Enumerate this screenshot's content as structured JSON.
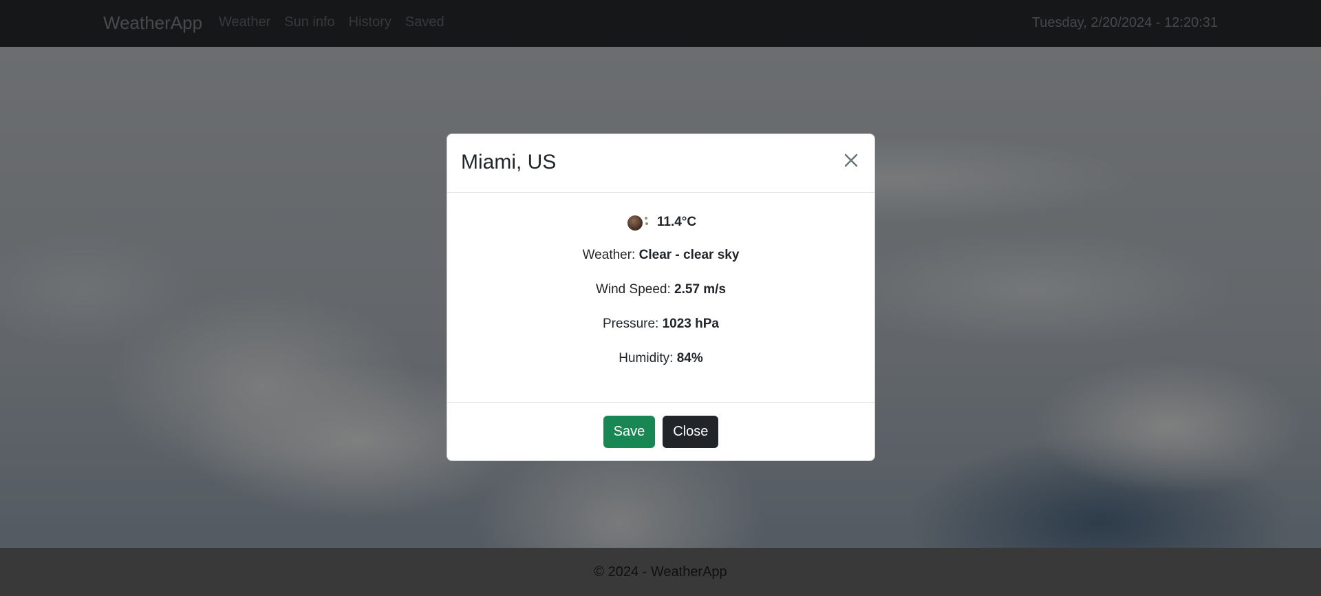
{
  "navbar": {
    "brand": "WeatherApp",
    "links": [
      "Weather",
      "Sun info",
      "History",
      "Saved"
    ],
    "datetime": "Tuesday, 2/20/2024 - 12:20:31"
  },
  "modal": {
    "title": "Miami, US",
    "temperature": "11.4°C",
    "weather_label": "Weather: ",
    "weather_value": "Clear - clear sky",
    "wind_label": "Wind Speed: ",
    "wind_value": "2.57 m/s",
    "pressure_label": "Pressure: ",
    "pressure_value": "1023 hPa",
    "humidity_label": "Humidity: ",
    "humidity_value": "84%",
    "save_label": "Save",
    "close_label": "Close",
    "weather_icon": "clear-sky-icon"
  },
  "footer": {
    "text": "© 2024 - WeatherApp"
  },
  "colors": {
    "save_button": "#198754",
    "close_button": "#212529",
    "navbar": "#212529"
  }
}
